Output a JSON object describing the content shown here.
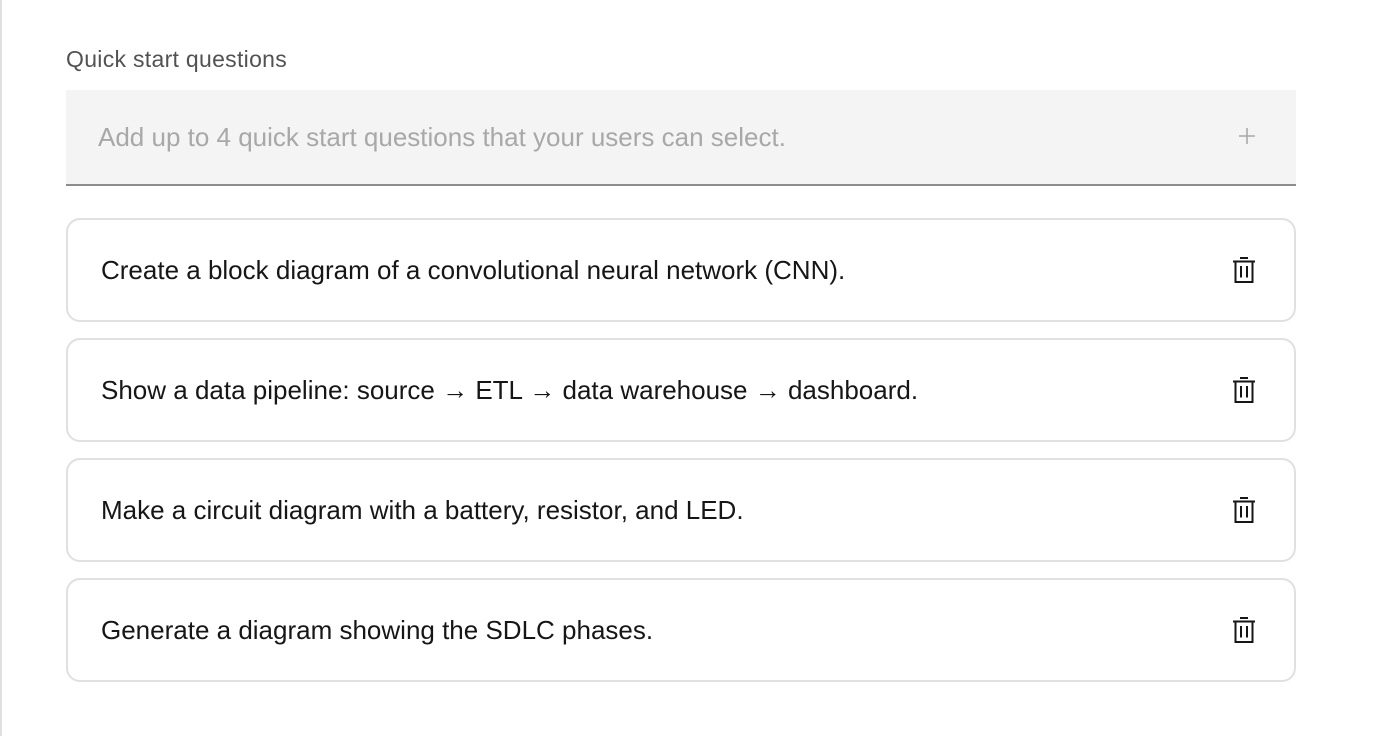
{
  "quick_start": {
    "label": "Quick start questions",
    "input_placeholder": "Add up to 4 quick start questions that your users can select.",
    "input_value": "",
    "add_icon": "plus-icon",
    "delete_icon": "trash-icon",
    "questions": [
      {
        "text": "Create a block diagram of a convolutional neural network (CNN)."
      },
      {
        "text": "Show a data pipeline: source → ETL → data warehouse → dashboard."
      },
      {
        "text": "Make a circuit diagram with a battery, resistor, and LED."
      },
      {
        "text": "Generate a diagram showing the SDLC phases."
      }
    ]
  },
  "colors": {
    "field_background": "#f4f4f4",
    "field_underline": "#8d8d8d",
    "card_border": "#e0e0e0",
    "text_primary": "#161616",
    "text_secondary": "#525252",
    "placeholder": "#a8a8a8"
  }
}
